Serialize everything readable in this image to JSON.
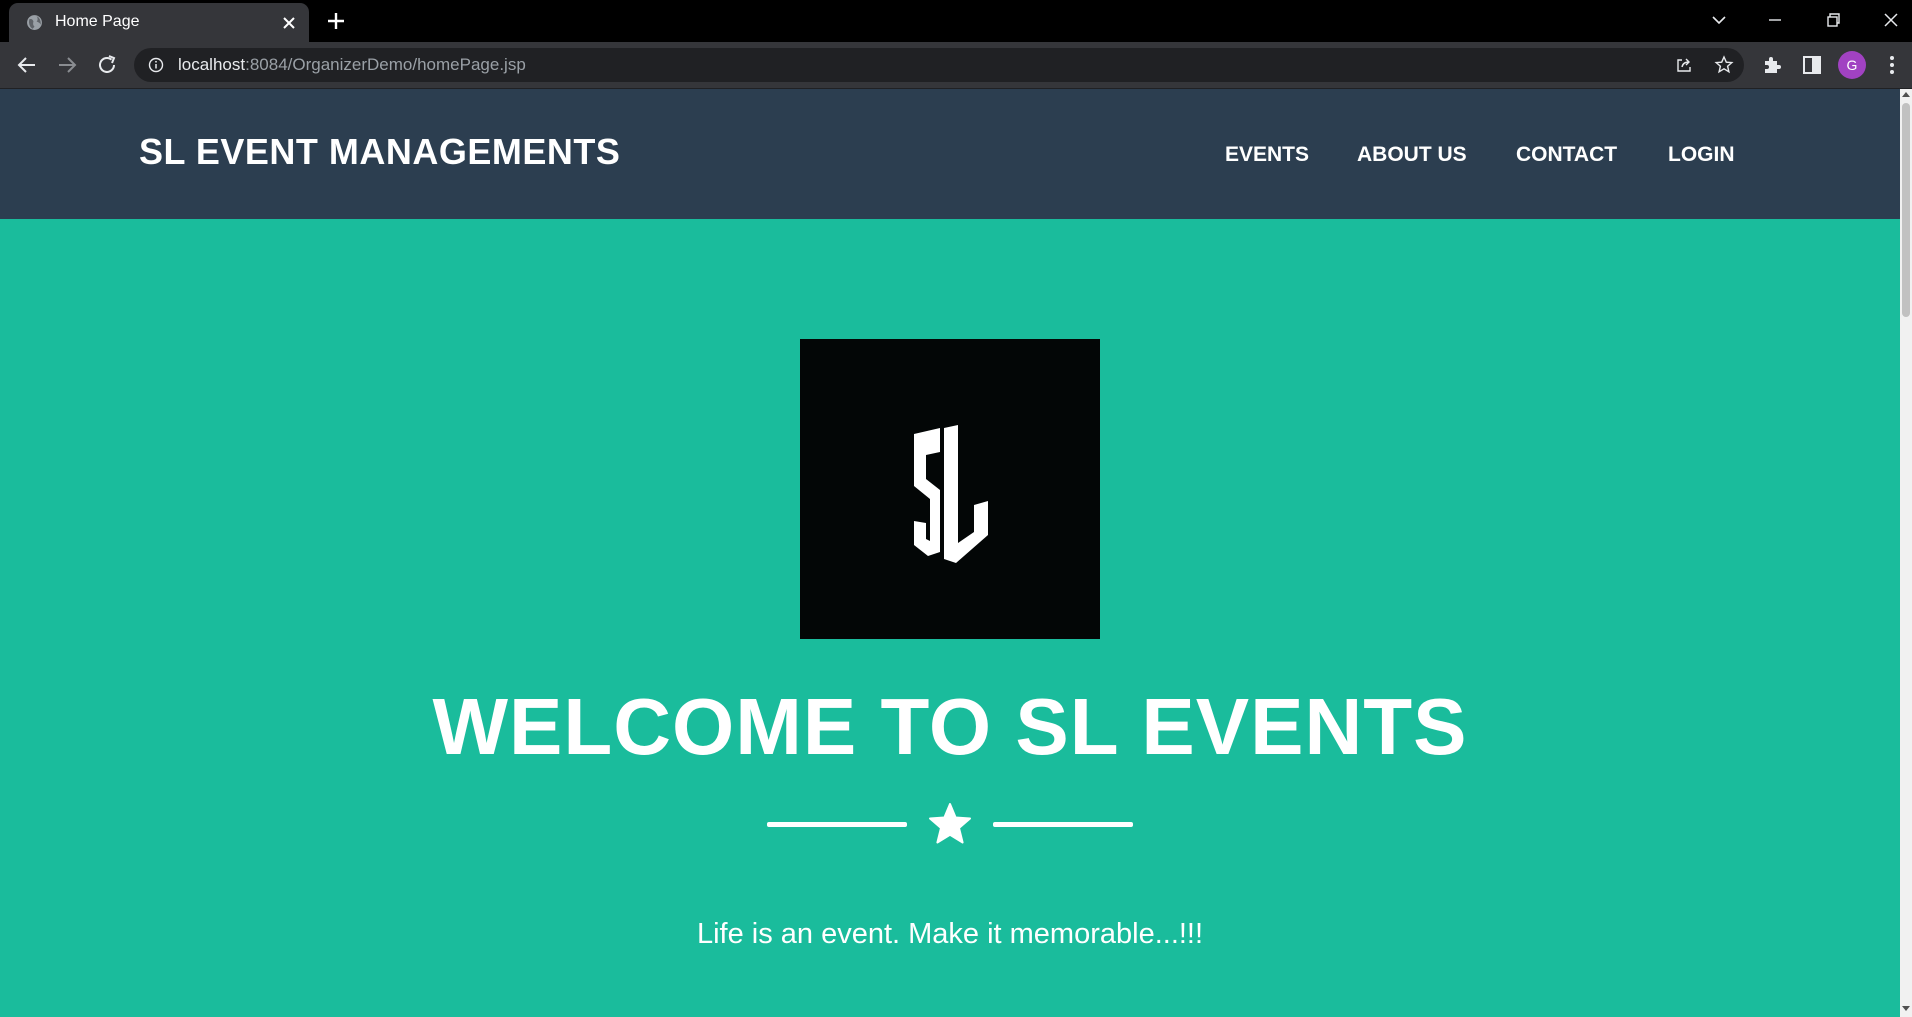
{
  "browser": {
    "tab": {
      "title": "Home Page",
      "favicon": "globe-icon"
    },
    "address": {
      "host": "localhost",
      "rest": ":8084/OrganizerDemo/homePage.jsp"
    },
    "profile_initial": "G",
    "icons": [
      "back-arrow-icon",
      "forward-arrow-icon",
      "reload-icon",
      "site-info-icon",
      "share-icon",
      "bookmark-star-icon",
      "extensions-puzzle-icon",
      "side-panel-icon",
      "menu-dots-icon",
      "tab-search-chevron-icon",
      "minimize-icon",
      "restore-icon",
      "close-window-icon",
      "new-tab-plus-icon"
    ]
  },
  "site": {
    "brand": "SL EVENT MANAGEMENTS",
    "nav": {
      "events": "EVENTS",
      "about": "ABOUT US",
      "contact": "CONTACT",
      "login": "LOGIN"
    },
    "hero": {
      "logo": "SL",
      "title": "WELCOME TO SL EVENTS",
      "divider_icon": "star-icon",
      "tagline": "Life is an event. Make it memorable...!!!"
    }
  },
  "colors": {
    "navbar": "#2c3e50",
    "hero_background": "#1abc9c",
    "logo_background": "#030606",
    "text": "#ffffff"
  }
}
